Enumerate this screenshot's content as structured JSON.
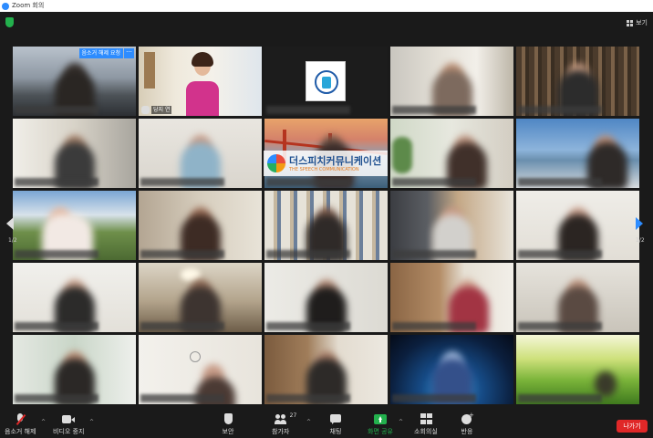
{
  "window": {
    "title": "Zoom 회의"
  },
  "topbar": {
    "view_label": "보기"
  },
  "gallery": {
    "host_name": "당지 연",
    "raise_hand_request": "음소거 해제 요청",
    "more_menu": "···",
    "page_indicator_left": "1/2",
    "page_indicator_right": "1/2"
  },
  "watermark": {
    "korean": "더스피치커뮤니케이션",
    "english": "THE SPEECH COMMUNICATION"
  },
  "toolbar": {
    "mute_label": "음소거 해제",
    "video_label": "비디오 중지",
    "security_label": "보안",
    "participants_label": "참가자",
    "participants_count": "27",
    "chat_label": "채팅",
    "share_label": "화면 공유",
    "rooms_label": "소회의실",
    "reactions_label": "반응",
    "leave_label": "나가기"
  },
  "colors": {
    "accent_blue": "#2d8cff",
    "leave_red": "#e02828",
    "share_green": "#23b14d",
    "active_speaker": "#e5ee5c"
  }
}
